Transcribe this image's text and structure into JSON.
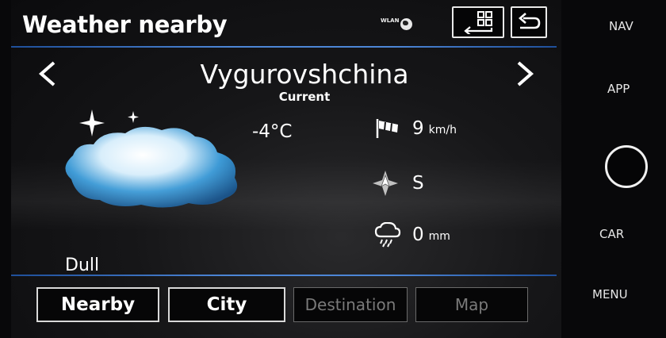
{
  "header": {
    "title": "Weather nearby",
    "wlan_label": "WLAN"
  },
  "location": {
    "prev_icon": "chevron-left",
    "next_icon": "chevron-right",
    "city": "Vygurovshchina",
    "subtitle": "Current"
  },
  "weather": {
    "temperature": "-4°C",
    "condition": "Dull",
    "wind_speed": "9",
    "wind_unit": "km/h",
    "wind_direction": "S",
    "precipitation": "0",
    "precipitation_unit": "mm"
  },
  "tabs": [
    {
      "label": "Nearby",
      "enabled": true
    },
    {
      "label": "City",
      "enabled": true
    },
    {
      "label": "Destination",
      "enabled": false
    },
    {
      "label": "Map",
      "enabled": false
    }
  ],
  "side_panel": {
    "nav": "NAV",
    "app": "APP",
    "car": "CAR",
    "menu": "MENU"
  },
  "colors": {
    "accent_line": "#4d86d6",
    "background": "#161618",
    "cloud": "#2e8fd0"
  }
}
